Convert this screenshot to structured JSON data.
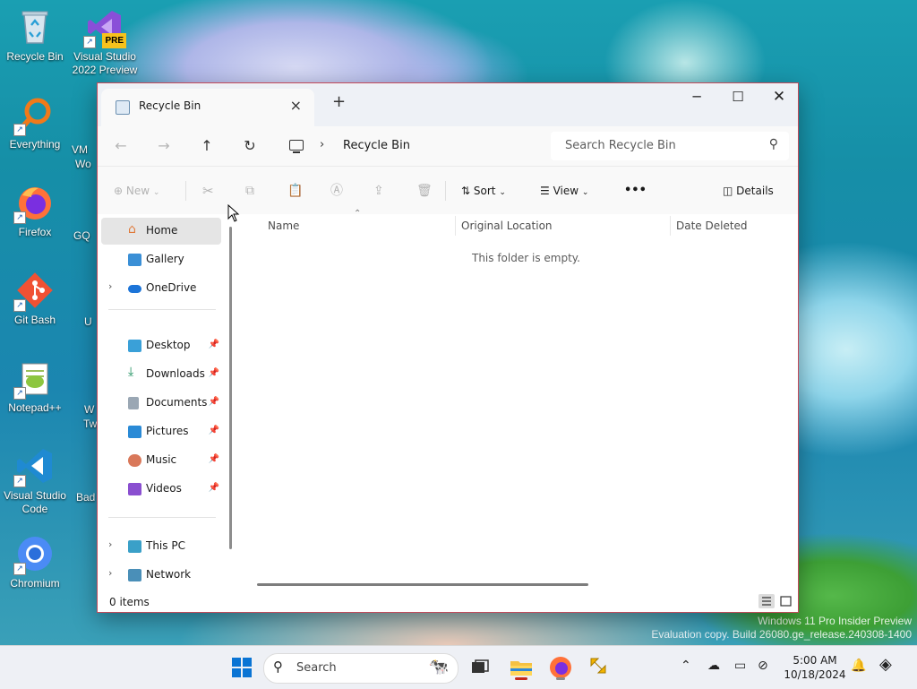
{
  "desktop": {
    "icons": [
      {
        "id": "recycle-bin",
        "label": "Recycle Bin"
      },
      {
        "id": "visual-studio-2022-preview",
        "label": "Visual Studio 2022 Preview",
        "badge": "PRE"
      },
      {
        "id": "everything",
        "label": "Everything"
      },
      {
        "id": "firefox",
        "label": "Firefox"
      },
      {
        "id": "git-bash",
        "label": "Git Bash"
      },
      {
        "id": "notepad-plus-plus",
        "label": "Notepad++"
      },
      {
        "id": "visual-studio-code",
        "label": "Visual Studio Code"
      },
      {
        "id": "chromium",
        "label": "Chromium"
      }
    ],
    "partial_labels": [
      "VM",
      "Wo",
      "GQ",
      "U",
      "W",
      "Tw",
      "Bad"
    ],
    "watermark": {
      "line1": "Windows 11 Pro Insider Preview",
      "line2": "Evaluation copy. Build 26080.ge_release.240308-1400"
    }
  },
  "explorer": {
    "tab_title": "Recycle Bin",
    "new_tab_icon": "plus-icon",
    "window_controls": [
      "minimize",
      "maximize",
      "close"
    ],
    "breadcrumb": [
      "Recycle Bin"
    ],
    "search_placeholder": "Search Recycle Bin",
    "toolbar": {
      "new_label": "New",
      "sort_label": "Sort",
      "view_label": "View",
      "more_label": "•••",
      "details_label": "Details",
      "disabled_icons": [
        "cut-icon",
        "copy-icon",
        "paste-icon",
        "rename-icon",
        "share-icon",
        "delete-icon"
      ]
    },
    "sidebar": {
      "group1": [
        {
          "label": "Home",
          "icon": "home-icon",
          "selected": true
        },
        {
          "label": "Gallery",
          "icon": "gallery-icon"
        },
        {
          "label": "OneDrive",
          "icon": "onedrive-icon",
          "expandable": true
        }
      ],
      "group2": [
        {
          "label": "Desktop",
          "icon": "desktop-folder-icon",
          "pinned": true
        },
        {
          "label": "Downloads",
          "icon": "downloads-icon",
          "pinned": true
        },
        {
          "label": "Documents",
          "icon": "documents-icon",
          "pinned": true
        },
        {
          "label": "Pictures",
          "icon": "pictures-icon",
          "pinned": true
        },
        {
          "label": "Music",
          "icon": "music-icon",
          "pinned": true
        },
        {
          "label": "Videos",
          "icon": "videos-icon",
          "pinned": true
        }
      ],
      "group3": [
        {
          "label": "This PC",
          "icon": "this-pc-icon",
          "expandable": true
        },
        {
          "label": "Network",
          "icon": "network-icon",
          "expandable": true
        }
      ]
    },
    "columns": [
      "Name",
      "Original Location",
      "Date Deleted"
    ],
    "empty_message": "This folder is empty.",
    "status": {
      "item_count": "0 items"
    }
  },
  "taskbar": {
    "search_placeholder": "Search",
    "pinned": [
      "start-icon",
      "search-box",
      "task-view-icon",
      "file-explorer-icon",
      "firefox-icon",
      "app-icon"
    ],
    "clock": {
      "time": "5:00 AM",
      "date": "10/18/2024"
    },
    "colors": {
      "accent": "#0067c0",
      "window_border": "#c24a5a"
    }
  }
}
